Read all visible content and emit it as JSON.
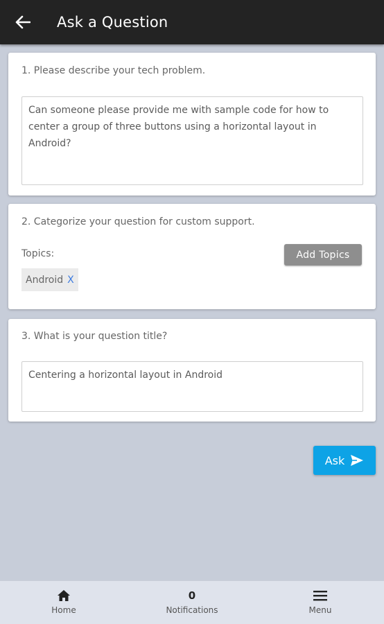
{
  "header": {
    "title": "Ask a Question",
    "back_icon": "arrow-back-icon"
  },
  "section1": {
    "label": "1. Please describe your tech problem.",
    "value": "Can someone please provide me with sample code for how to center a group of three buttons using a horizontal layout in Android?"
  },
  "section2": {
    "label": "2. Categorize your question for custom support.",
    "topics_label": "Topics:",
    "add_topics_label": "Add Topics",
    "topics": [
      {
        "label": "Android",
        "remove": "X"
      }
    ]
  },
  "section3": {
    "label": "3. What is your question title?",
    "value": "Centering a horizontal layout in Android"
  },
  "ask_button": {
    "label": "Ask",
    "icon": "send-icon"
  },
  "bottom_nav": {
    "home": {
      "label": "Home",
      "icon": "home-icon"
    },
    "notifications": {
      "label": "Notifications",
      "count": "0"
    },
    "menu": {
      "label": "Menu",
      "icon": "menu-icon"
    }
  },
  "colors": {
    "appbar": "#232323",
    "background": "#c7cdd9",
    "ask_button": "#0da3e6",
    "add_topics_button": "#8e8e8e",
    "chip_remove": "#3d7be0"
  }
}
